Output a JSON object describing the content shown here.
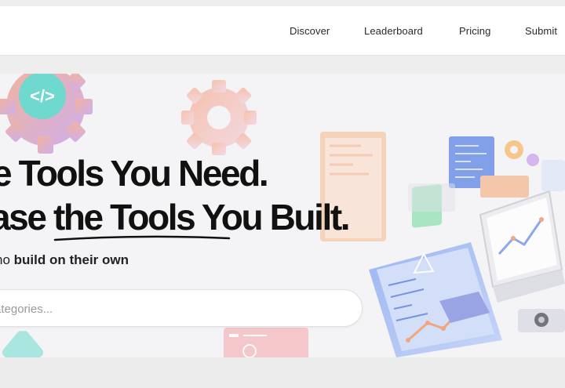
{
  "nav": {
    "items": [
      {
        "label": "Discover"
      },
      {
        "label": "Leaderboard"
      },
      {
        "label": "Pricing"
      },
      {
        "label": "Submit"
      }
    ]
  },
  "hero": {
    "headline_line1": "e Tools You Need.",
    "headline_line2_a": "ase ",
    "headline_line2_b": "the Tools",
    "headline_line2_c": " You Built.",
    "subtitle_pre": "ho ",
    "subtitle_bold": "build on their own",
    "code_badge": "</>"
  },
  "search": {
    "placeholder": "ategories..."
  },
  "colors": {
    "accent_teal": "#3fc6b4",
    "accent_orange": "#f08c5a",
    "illustration_blue": "#6a8fe8"
  }
}
